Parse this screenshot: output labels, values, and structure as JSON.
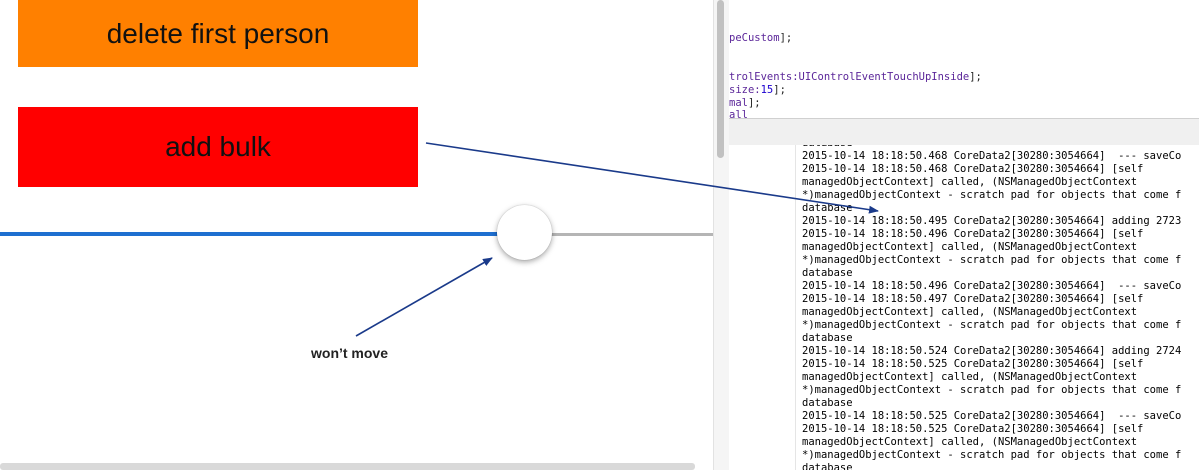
{
  "simulator": {
    "delete_button": "delete first person",
    "add_bulk_button": "add bulk",
    "slider_value": 0.736,
    "annotation": "won’t move",
    "colors": {
      "orange": "#ff8000",
      "red": "#ff0000",
      "slider_min_track": "#1e6fd0",
      "arrow": "#1a3a8a"
    }
  },
  "code_editor": {
    "lines": [
      {
        "plain": "",
        "purple": "peCustom",
        "suffix": "];"
      },
      {
        "plain": "",
        "purple": "trolEvents:UIControlEventTouchUpInside",
        "suffix": "];"
      },
      {
        "plain": "",
        "purple": "size:",
        "num": "15",
        "suffix": "];"
      },
      {
        "plain": "",
        "purple": "mal",
        "suffix": "];"
      },
      {
        "plain": "",
        "purple": "all",
        "suffix": ""
      }
    ]
  },
  "console": {
    "lines": [
      "database",
      "2015-10-14 18:18:50.468 CoreData2[30280:3054664]  --- saveCo",
      "2015-10-14 18:18:50.468 CoreData2[30280:3054664] [self",
      "managedObjectContext] called, (NSManagedObjectContext",
      "*)managedObjectContext - scratch pad for objects that come f",
      "database",
      "2015-10-14 18:18:50.495 CoreData2[30280:3054664] adding 2723",
      "2015-10-14 18:18:50.496 CoreData2[30280:3054664] [self",
      "managedObjectContext] called, (NSManagedObjectContext",
      "*)managedObjectContext - scratch pad for objects that come f",
      "database",
      "2015-10-14 18:18:50.496 CoreData2[30280:3054664]  --- saveCo",
      "2015-10-14 18:18:50.497 CoreData2[30280:3054664] [self",
      "managedObjectContext] called, (NSManagedObjectContext",
      "*)managedObjectContext - scratch pad for objects that come f",
      "database",
      "2015-10-14 18:18:50.524 CoreData2[30280:3054664] adding 2724",
      "2015-10-14 18:18:50.525 CoreData2[30280:3054664] [self",
      "managedObjectContext] called, (NSManagedObjectContext",
      "*)managedObjectContext - scratch pad for objects that come f",
      "database",
      "2015-10-14 18:18:50.525 CoreData2[30280:3054664]  --- saveCo",
      "2015-10-14 18:18:50.525 CoreData2[30280:3054664] [self",
      "managedObjectContext] called, (NSManagedObjectContext",
      "*)managedObjectContext - scratch pad for objects that come f",
      "database"
    ]
  }
}
